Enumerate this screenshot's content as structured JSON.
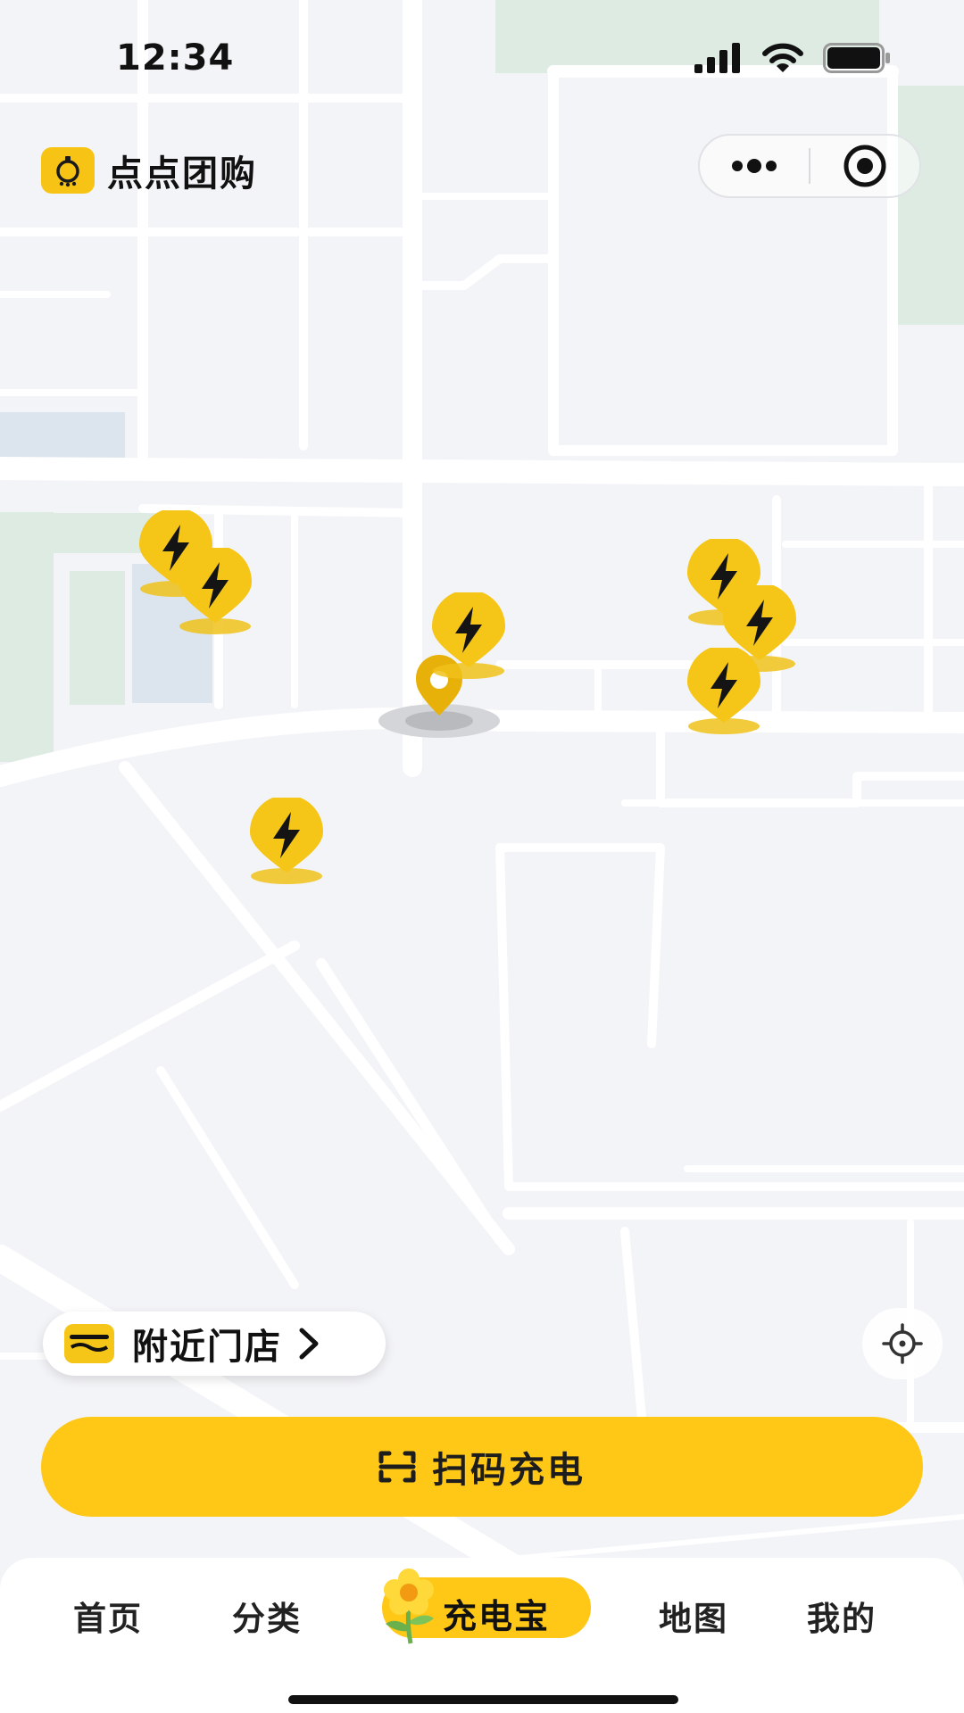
{
  "status_bar": {
    "time": "12:34"
  },
  "header": {
    "app_name": "点点团购"
  },
  "map": {
    "marker_icon": "lightning-bolt-icon",
    "marker_color": "#f4c20f",
    "user_location_color": "#e7b10a"
  },
  "nearby": {
    "label": "附近门店"
  },
  "scan": {
    "label": "扫码充电"
  },
  "tabs": [
    {
      "label": "首页"
    },
    {
      "label": "分类"
    },
    {
      "label": "充电宝"
    },
    {
      "label": "地图"
    },
    {
      "label": "我的"
    }
  ],
  "colors": {
    "accent": "#ffc716"
  }
}
